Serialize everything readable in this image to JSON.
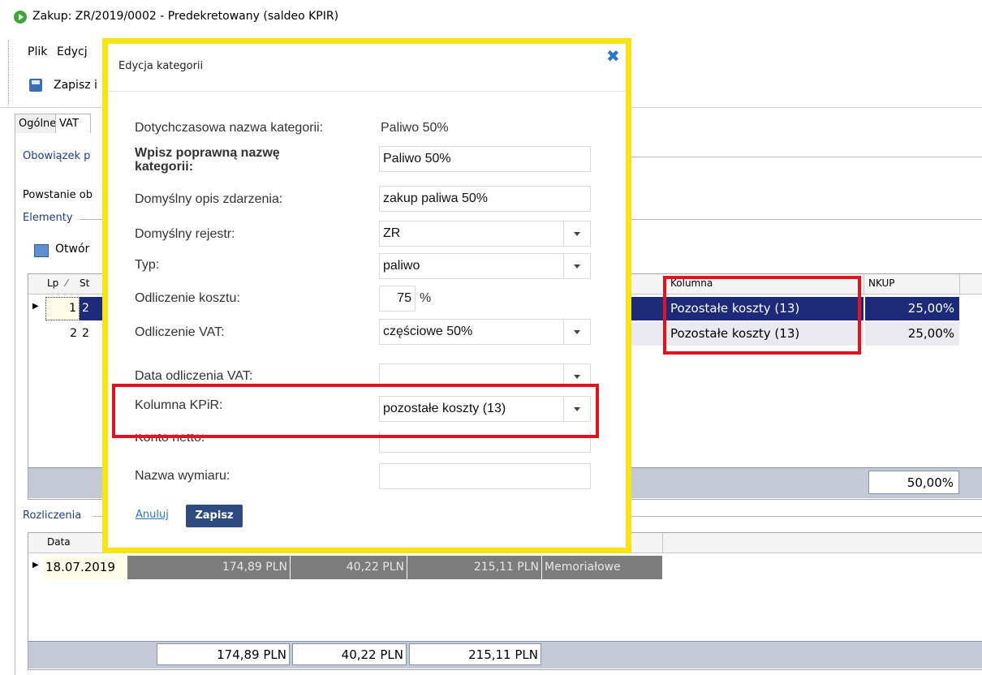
{
  "window": {
    "title": "Zakup: ZR/2019/0002 - Predekretowany (saldeo KPIR)"
  },
  "menu": {
    "items": [
      "Plik",
      "Edycj"
    ]
  },
  "toolbar": {
    "save_label": "Zapisz i"
  },
  "tabs": [
    {
      "label": "Ogólne"
    },
    {
      "label": "VAT"
    }
  ],
  "main": {
    "obowiazek_label": "Obowiązek p",
    "powstanie_label": "Powstanie ob",
    "elementy_label": "Elementy",
    "otworz_label": "Otwór",
    "elements_grid": {
      "headers": [
        "Lp",
        "St",
        "Kolumna",
        "NKUP"
      ],
      "rows": [
        {
          "lp": "1",
          "st": "2",
          "kolumna": "Pozostałe koszty (13)",
          "nkup": "25,00%"
        },
        {
          "lp": "2",
          "st": "2",
          "kolumna": "Pozostałe koszty (13)",
          "nkup": "25,00%"
        }
      ],
      "footer_total": "50,00%"
    },
    "rozliczenia_label": "Rozliczenia",
    "rozliczenia_grid": {
      "headers": [
        "Data"
      ],
      "row": {
        "data": "18.07.2019",
        "netto": "174,89 PLN",
        "vat": "40,22 PLN",
        "brutto": "215,11 PLN",
        "typ": "Memoriałowe"
      },
      "footer": {
        "netto": "174,89 PLN",
        "vat": "40,22 PLN",
        "brutto": "215,11 PLN"
      }
    }
  },
  "dialog": {
    "title": "Edycja kategorii",
    "fields": {
      "current_name_label": "Dotychczasowa nazwa kategorii:",
      "current_name_value": "Paliwo 50%",
      "new_name_label": "Wpisz poprawną nazwę kategorii:",
      "new_name_value": "Paliwo 50%",
      "default_desc_label": "Domyślny opis zdarzenia:",
      "default_desc_value": "zakup paliwa 50%",
      "default_register_label": "Domyślny rejestr:",
      "default_register_value": "ZR",
      "type_label": "Typ:",
      "type_value": "paliwo",
      "cost_deduction_label": "Odliczenie kosztu:",
      "cost_deduction_value": "75",
      "cost_deduction_unit": "%",
      "vat_deduction_label": "Odliczenie VAT:",
      "vat_deduction_value": "częściowe 50%",
      "vat_date_label": "Data odliczenia VAT:",
      "kpir_column_label": "Kolumna KPiR:",
      "kpir_column_value": "pozostałe koszty (13)",
      "net_account_label": "Konto netto:",
      "dimension_label": "Nazwa wymiaru:"
    },
    "cancel_label": "Anuluj",
    "save_label": "Zapisz"
  },
  "colors": {
    "highlight_yellow": "#f6e415",
    "highlight_red": "#e3121c",
    "selection": "#1d2a7a",
    "button": "#2e4b7f",
    "link": "#2a78c9"
  }
}
